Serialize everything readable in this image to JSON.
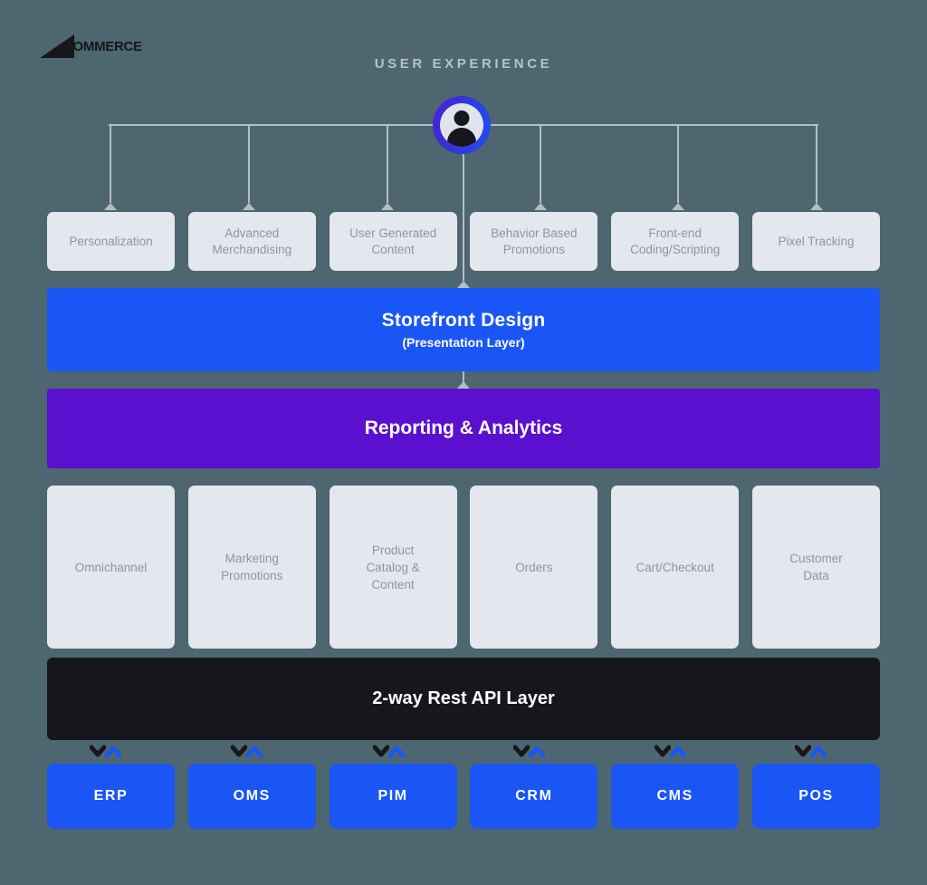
{
  "brand": {
    "logo_text": "COMMERCE",
    "logo_full": "BIGCOMMERCE"
  },
  "header": {
    "section_title": "USER EXPERIENCE"
  },
  "avatar": {
    "icon": "user-avatar-icon"
  },
  "ux_layer": {
    "items": [
      {
        "label": "Personalization"
      },
      {
        "label": "Advanced\nMerchandising"
      },
      {
        "label": "User Generated\nContent"
      },
      {
        "label": "Behavior Based\nPromotions"
      },
      {
        "label": "Front-end\nCoding/Scripting"
      },
      {
        "label": "Pixel Tracking"
      }
    ]
  },
  "storefront": {
    "title": "Storefront Design",
    "subtitle": "(Presentation Layer)"
  },
  "analytics": {
    "title": "Reporting & Analytics"
  },
  "capabilities": {
    "items": [
      {
        "label": "Omnichannel"
      },
      {
        "label": "Marketing\nPromotions"
      },
      {
        "label": "Product\nCatalog &\nContent"
      },
      {
        "label": "Orders"
      },
      {
        "label": "Cart/Checkout"
      },
      {
        "label": "Customer\nData"
      }
    ]
  },
  "api_layer": {
    "title": "2-way Rest API Layer"
  },
  "systems": {
    "items": [
      {
        "label": "ERP"
      },
      {
        "label": "OMS"
      },
      {
        "label": "PIM"
      },
      {
        "label": "CRM"
      },
      {
        "label": "CMS"
      },
      {
        "label": "POS"
      }
    ]
  },
  "colors": {
    "background": "#4d666f",
    "card": "#e4e7ee",
    "card_text": "#8d979e",
    "blue": "#1a56f5",
    "purple": "#5a10ce",
    "black": "#16161c",
    "connector": "#b5bdc4",
    "heading": "#b9c1c6"
  }
}
